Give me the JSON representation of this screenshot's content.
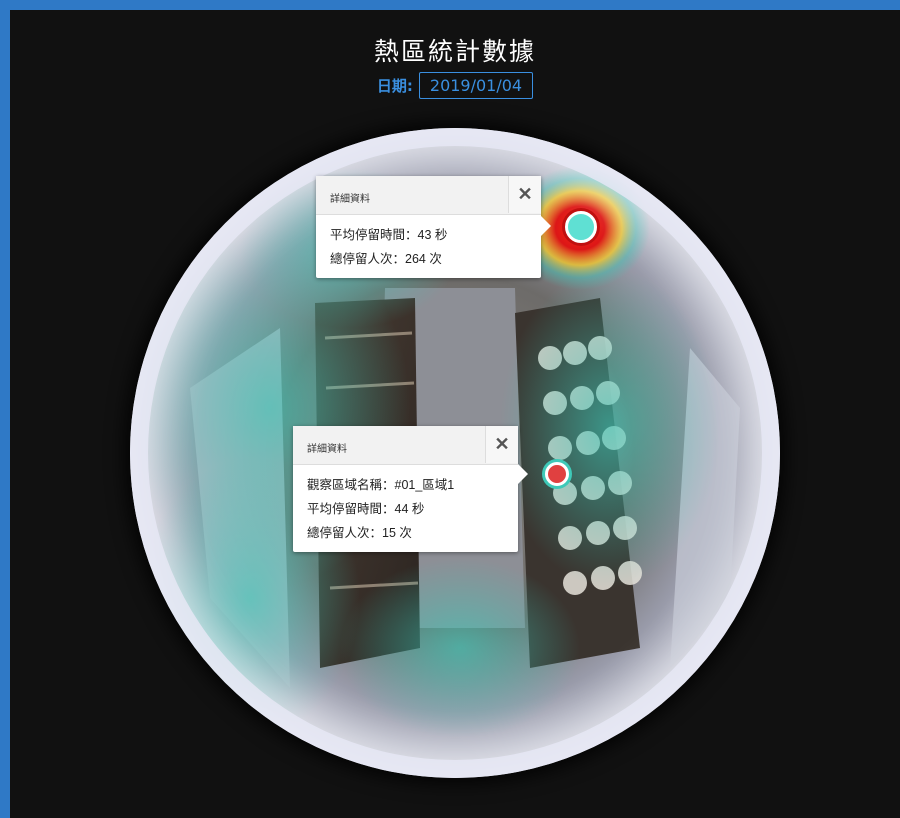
{
  "header": {
    "title": "熱區統計數據",
    "date_label": "日期:",
    "date_value": "2019/01/04"
  },
  "popups": [
    {
      "title": "詳細資料",
      "close_icon": "close-icon",
      "lines": [
        "平均停留時間：43 秒",
        "總停留人次：264 次"
      ]
    },
    {
      "title": "詳細資料",
      "close_icon": "close-icon",
      "lines": [
        "觀察區域名稱：#01_區域1",
        "平均停留時間：44 秒",
        "總停留人次：15 次"
      ]
    }
  ],
  "markers": [
    {
      "name": "hotspot-marker-1",
      "color": "#5fe0d3"
    },
    {
      "name": "hotspot-marker-2",
      "color": "#e04040"
    }
  ],
  "colors": {
    "accent": "#3a8fe0",
    "frame": "#2f79c6",
    "background": "#111111",
    "heat_hot": "#e01010",
    "heat_cool": "#3ec9b8"
  }
}
